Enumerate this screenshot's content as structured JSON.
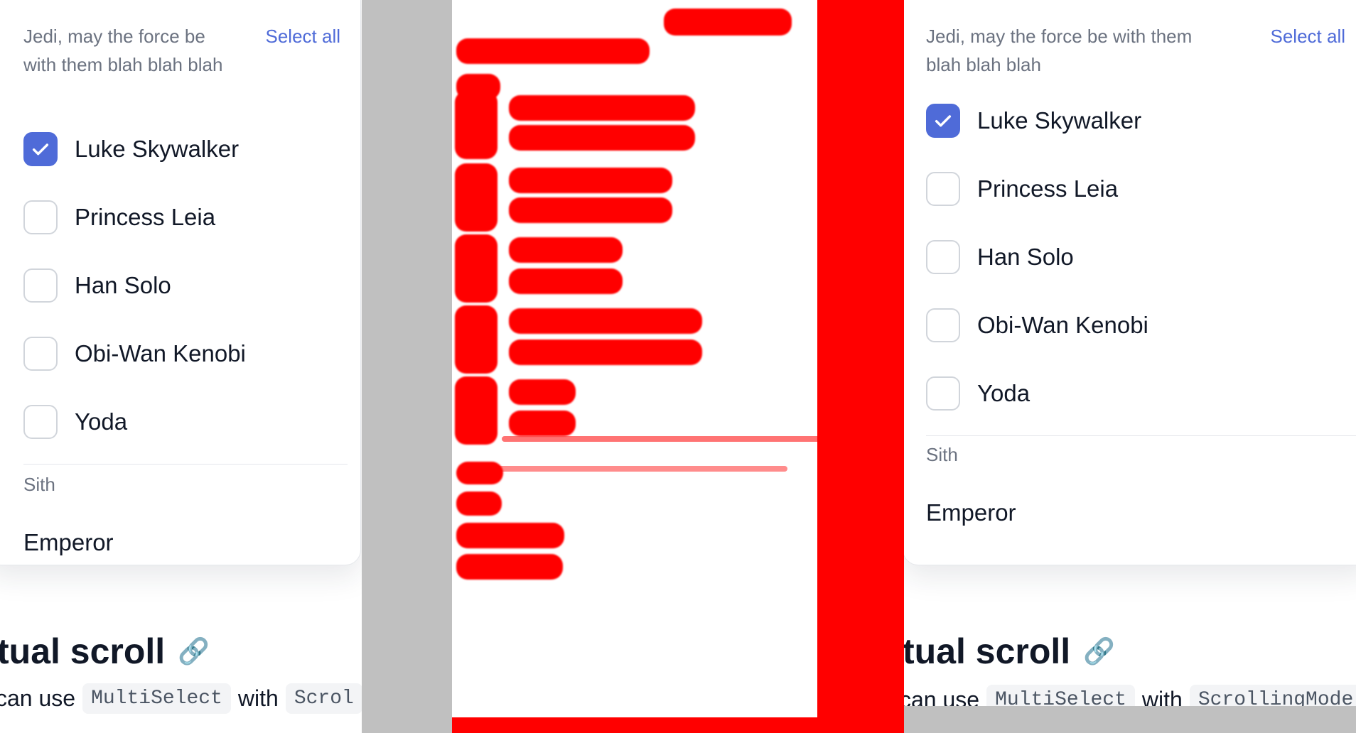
{
  "jedi_group": {
    "title_left": "Jedi, may the force be with them blah blah blah",
    "title_right": "Jedi, may the force be with them blah blah blah",
    "select_all_label": "Select all",
    "options": [
      {
        "label": "Luke Skywalker",
        "checked": true
      },
      {
        "label": "Princess Leia",
        "checked": false
      },
      {
        "label": "Han Solo",
        "checked": false
      },
      {
        "label": "Obi-Wan Kenobi",
        "checked": false
      },
      {
        "label": "Yoda",
        "checked": false
      }
    ]
  },
  "sith_group": {
    "title": "Sith",
    "first_option": "Emperor"
  },
  "section": {
    "heading": "tual scroll",
    "text_prefix": "can use",
    "code_1": "MultiSelect",
    "text_middle": "with",
    "code_2_left": "Scrol",
    "code_2_right": "ScrollingMode"
  },
  "colors": {
    "accent": "#4f6bd8",
    "diff_red": "#ff0000",
    "gray": "#c0c0c0"
  },
  "icons": [
    "checkmark-icon",
    "link-icon"
  ]
}
